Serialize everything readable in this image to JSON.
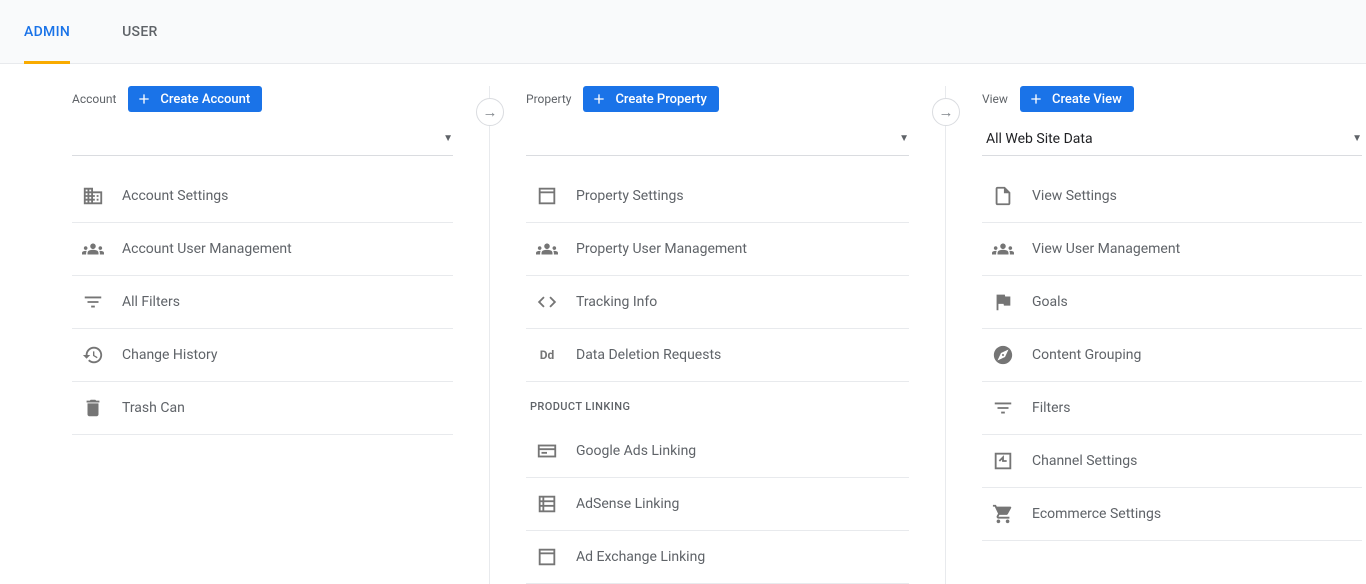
{
  "tabs": {
    "admin": "ADMIN",
    "user": "USER"
  },
  "columns": {
    "account": {
      "label": "Account",
      "create_btn": "Create Account",
      "dropdown": ""
    },
    "property": {
      "label": "Property",
      "create_btn": "Create Property",
      "dropdown": ""
    },
    "view": {
      "label": "View",
      "create_btn": "Create View",
      "dropdown": "All Web Site Data"
    }
  },
  "account_items": {
    "settings": "Account Settings",
    "user_mgmt": "Account User Management",
    "filters": "All Filters",
    "history": "Change History",
    "trash": "Trash Can"
  },
  "property_items": {
    "settings": "Property Settings",
    "user_mgmt": "Property User Management",
    "tracking": "Tracking Info",
    "data_deletion": "Data Deletion Requests",
    "section_product_linking": "PRODUCT LINKING",
    "ads_linking": "Google Ads Linking",
    "adsense": "AdSense Linking",
    "ad_exchange": "Ad Exchange Linking"
  },
  "view_items": {
    "settings": "View Settings",
    "user_mgmt": "View User Management",
    "goals": "Goals",
    "content_grouping": "Content Grouping",
    "filters": "Filters",
    "channel": "Channel Settings",
    "ecommerce": "Ecommerce Settings"
  },
  "icons": {
    "dd_label": "Dd"
  }
}
